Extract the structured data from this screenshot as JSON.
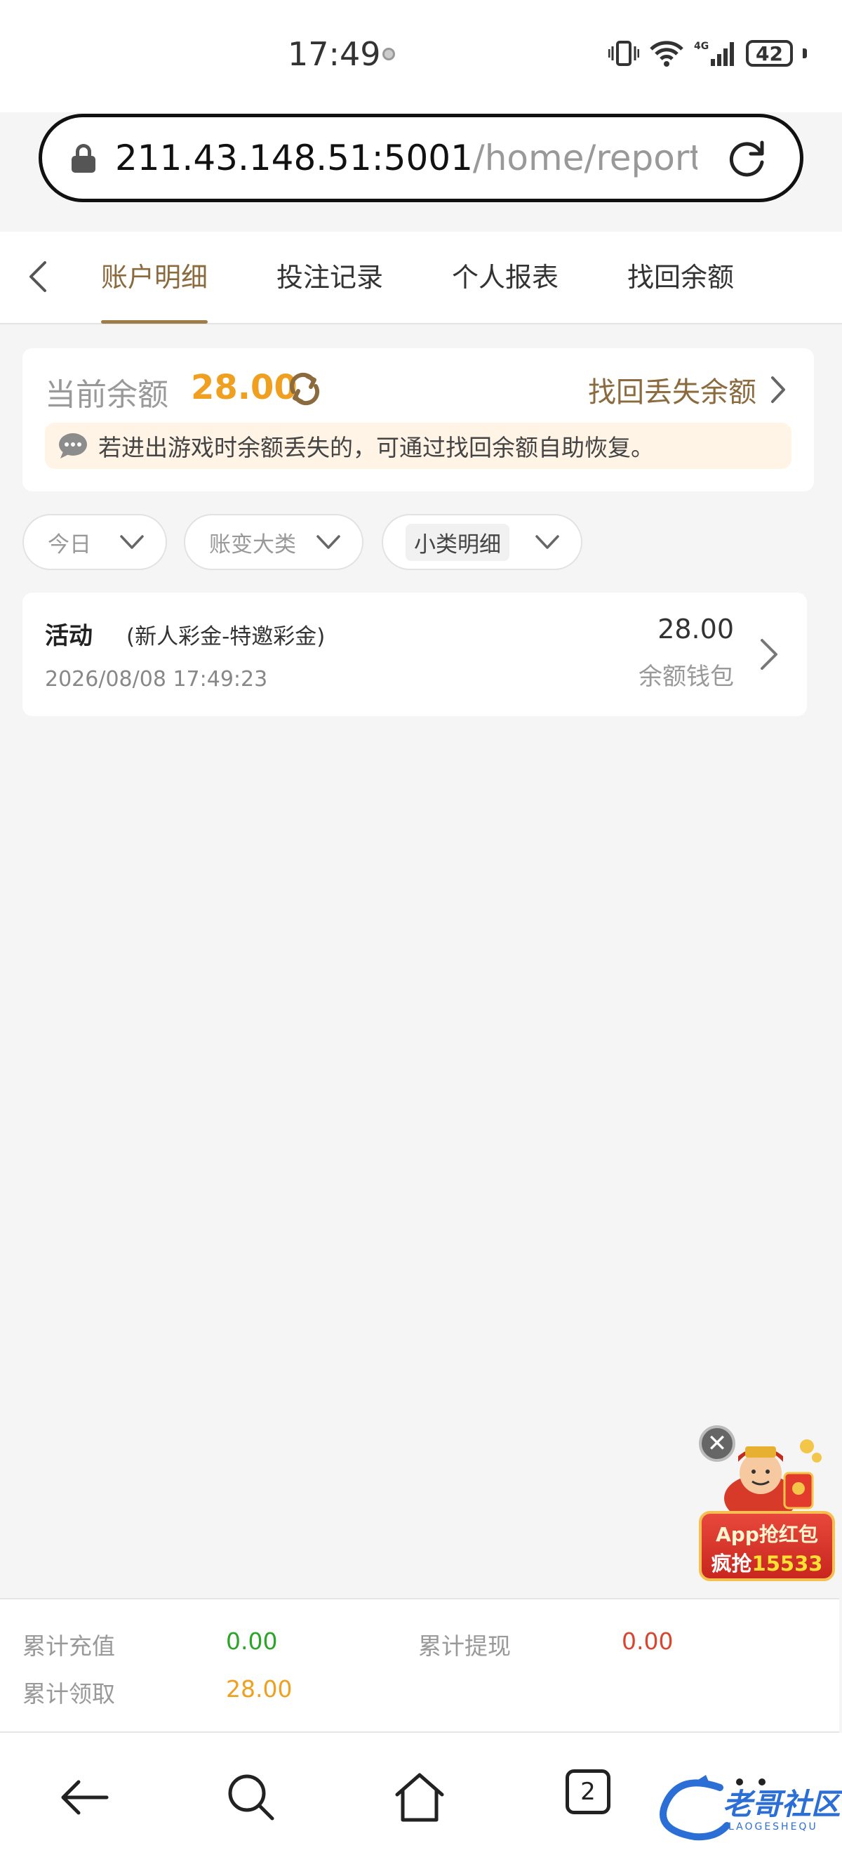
{
  "status": {
    "time": "17:49",
    "battery": "42"
  },
  "browser": {
    "url_host": "211.43.148.51:5001",
    "url_path": "/home/report?c",
    "tabs_count": "2"
  },
  "tabs": [
    "账户明细",
    "投注记录",
    "个人报表",
    "找回余额"
  ],
  "balance": {
    "label": "当前余额",
    "value": "28.00",
    "recover_link": "找回丢失余额",
    "notice": "若进出游戏时余额丢失的，可通过找回余额自助恢复。"
  },
  "filters": [
    "今日",
    "账变大类",
    "小类明细"
  ],
  "records": [
    {
      "type": "活动",
      "subtype": "(新人彩金-特邀彩金)",
      "time": "2026/08/08 17:49:23",
      "amount": "28.00",
      "wallet": "余额钱包"
    }
  ],
  "promo": {
    "line1": "App抢红包",
    "line2_prefix": "疯抢",
    "line2_number": "15533"
  },
  "totals": {
    "recharge_label": "累计充值",
    "recharge_value": "0.00",
    "withdraw_label": "累计提现",
    "withdraw_value": "0.00",
    "claimed_label": "累计领取",
    "claimed_value": "28.00"
  },
  "watermark": {
    "text": "老哥社区",
    "sub": "LAOGESHEQU"
  },
  "colors": {
    "accent": "#8b6a3e",
    "amount": "#f0a020",
    "green": "#2aa52a",
    "red": "#d9452e"
  }
}
